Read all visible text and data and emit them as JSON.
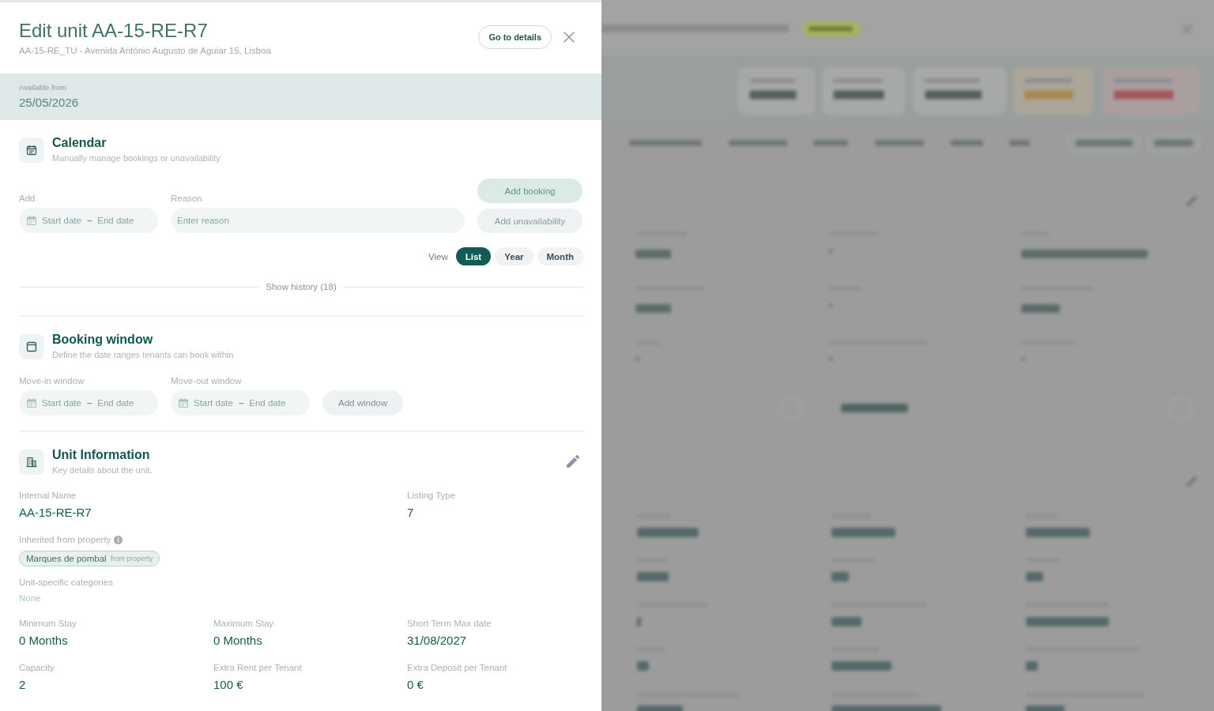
{
  "header": {
    "title": "Edit unit AA-15-RE-R7",
    "subtitle": "AA-15-RE_TU - Avenida António Augusto de Aguiar 15, Lisboa",
    "details_button": "Go to details"
  },
  "availability": {
    "label": "Available from",
    "value": "25/05/2026"
  },
  "calendar": {
    "title": "Calendar",
    "subtitle": "Manually manage bookings or unavailability",
    "date_field": {
      "label": "Add",
      "start_placeholder": "Start date",
      "separator": "–",
      "end_placeholder": "End date"
    },
    "reason_field": {
      "label": "Reason",
      "placeholder": "Enter reason"
    },
    "buttons": [
      {
        "label": "Add booking",
        "kind": "primary"
      },
      {
        "label": "Add unavailability",
        "kind": "secondary"
      }
    ],
    "view_label": "View",
    "views": [
      {
        "label": "List",
        "selected": true
      },
      {
        "label": "Year",
        "selected": false
      },
      {
        "label": "Month",
        "selected": false
      }
    ],
    "history_link": "Show history (18)"
  },
  "booking_window": {
    "title": "Booking window",
    "subtitle": "Define the date ranges tenants can book within",
    "date_fields": [
      {
        "label": "Move-in window",
        "start_placeholder": "Start date",
        "separator": "–",
        "end_placeholder": "End date"
      },
      {
        "label": "Move-out window",
        "start_placeholder": "Start date",
        "separator": "–",
        "end_placeholder": "End date"
      }
    ],
    "button": "Add window"
  },
  "unit_information": {
    "title": "Unit Information",
    "subtitle": "Key details about the unit.",
    "top_fields": [
      {
        "label": "Internal Name",
        "value": "AA-15-RE-R7"
      },
      {
        "label": "Listing Type",
        "value": "7"
      }
    ],
    "inherited": {
      "label": "Inherited from property",
      "tags": [
        {
          "name": "Marques de pombal",
          "source": "from property"
        }
      ]
    },
    "categories": {
      "label": "Unit-specific categories",
      "empty_text": "None"
    },
    "fields": [
      {
        "label": "Minimum Stay",
        "value": "0 Months"
      },
      {
        "label": "Maximum Stay",
        "value": "0 Months"
      },
      {
        "label": "Short Term Max date",
        "value": "31/08/2027"
      },
      {
        "label": "Capacity",
        "value": "2"
      },
      {
        "label": "Extra Rent per Tenant",
        "value": "100 €"
      },
      {
        "label": "Extra Deposit per Tenant",
        "value": "0 €"
      }
    ]
  }
}
